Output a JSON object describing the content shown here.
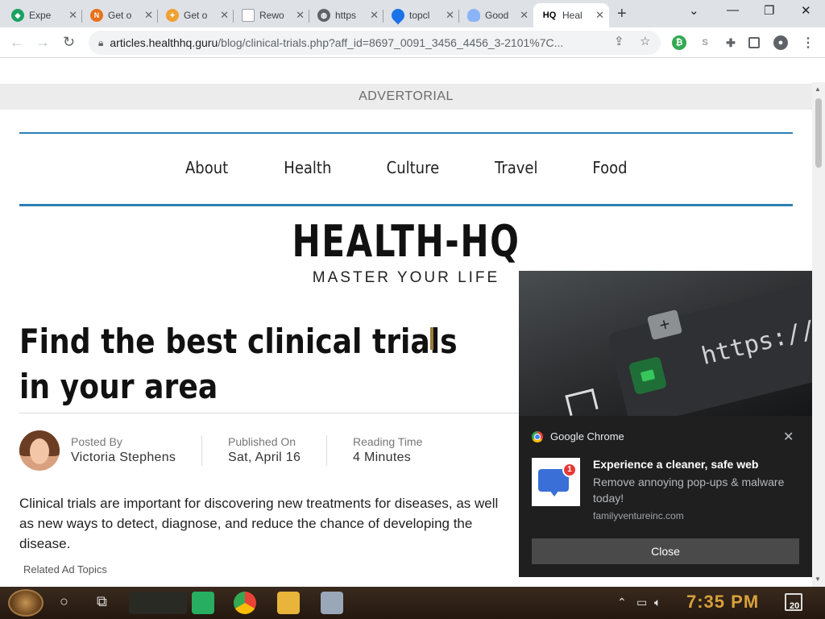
{
  "tabs": [
    {
      "title": "Expe",
      "favicon": "green-diamond-icon",
      "color": "#1aa260"
    },
    {
      "title": "Get o",
      "favicon": "n-badge-icon",
      "color": "#e8711a"
    },
    {
      "title": "Get o",
      "favicon": "flame-icon",
      "color": "#f0a030"
    },
    {
      "title": "Rewo",
      "favicon": "document-icon",
      "color": "#9aa0a6"
    },
    {
      "title": "https",
      "favicon": "globe-icon",
      "color": "#5f6368"
    },
    {
      "title": "topcl",
      "favicon": "location-pin-icon",
      "color": "#1a73e8"
    },
    {
      "title": "Good",
      "favicon": "cloud-icon",
      "color": "#8ab4f8"
    },
    {
      "title": "Heal",
      "favicon": "hq-icon",
      "color": "#000000",
      "fav_text": "HQ"
    }
  ],
  "address": {
    "domain": "articles.healthhq.guru",
    "path": "/blog/clinical-trials.php?aff_id=8697_0091_3456_4456_3-2101%7C..."
  },
  "page": {
    "advertorial": "ADVERTORIAL",
    "menu": [
      "About",
      "Health",
      "Culture",
      "Travel",
      "Food"
    ],
    "logo": "HEALTH-HQ",
    "tagline": "MASTER YOUR LIFE",
    "headline": "Find the best clinical trials in your area",
    "posted_by_label": "Posted By",
    "author": "Victoria Stephens",
    "published_label": "Published On",
    "published_date": "Sat, April 16",
    "reading_label": "Reading Time",
    "reading_time": "4 Minutes",
    "intro": "Clinical trials are important for discovering new treatments for diseases, as well as new ways to detect, diagnose, and reduce the chance of developing the disease.",
    "related": "Related Ad Topics",
    "accent_color": "#2b7fb5"
  },
  "notification": {
    "app": "Google Chrome",
    "hero_url": "https://w",
    "badge_count": "1",
    "title": "Experience a cleaner, safe web",
    "body": "Remove annoying pop-ups & malware today!",
    "site": "familyventureinc.com",
    "button": "Close"
  },
  "taskbar": {
    "clock": "7:35 PM",
    "notification_count": "20"
  }
}
